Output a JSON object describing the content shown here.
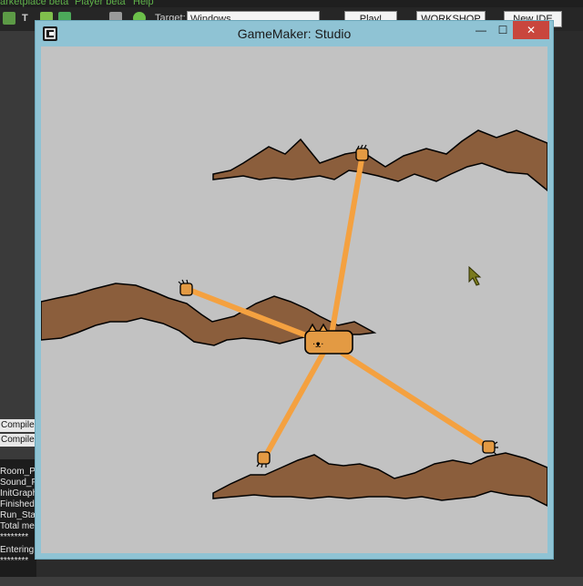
{
  "menubar": {
    "items": [
      "arketplace beta",
      "Player beta",
      "Help"
    ]
  },
  "toolbar": {
    "target_label": "Target:",
    "target_value": "Windows",
    "buttons": [
      "Play!",
      "WORKSHOP",
      "New IDE"
    ],
    "t_label": "T"
  },
  "left_pane": {
    "tabs": [
      "CompileF",
      "Compile"
    ],
    "log_lines": [
      "Room_Po",
      "Sound_P",
      "InitGraph",
      "Finished",
      "Run_Sta",
      "Total me",
      "********",
      "Entering",
      "********"
    ]
  },
  "window": {
    "title": "GameMaker: Studio",
    "minimize_glyph": "—",
    "maximize_glyph": "☐",
    "close_glyph": "✕"
  },
  "game": {
    "background_color": "#c2c2c2",
    "terrain_color": "#8b5e3c",
    "rope_color": "#f4a140",
    "character_color": "#e39a43",
    "character_face": "·ᴥ·"
  },
  "colors": {
    "window_frame": "#8fc3d4",
    "close_button": "#c9463d",
    "menu_text": "#5fb04a"
  }
}
